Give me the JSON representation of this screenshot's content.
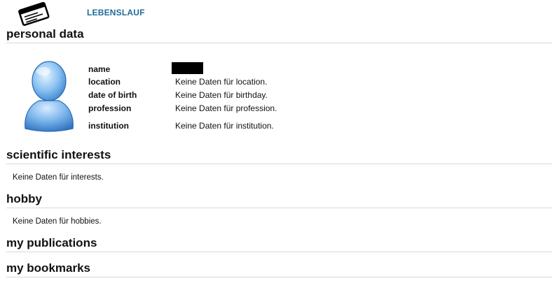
{
  "header": {
    "title": "LEBENSLAUF",
    "logo_icon": "id-card-icon"
  },
  "personal": {
    "heading": "personal data",
    "avatar_icon": "user-avatar-icon",
    "fields": [
      {
        "label": "name",
        "value": ""
      },
      {
        "label": "location",
        "value": "Keine Daten für location."
      },
      {
        "label": "date of birth",
        "value": "Keine Daten für birthday."
      },
      {
        "label": "profession",
        "value": "Keine Daten für profession."
      },
      {
        "label": "institution",
        "value": "Keine Daten für institution."
      }
    ]
  },
  "interests": {
    "heading": "scientific interests",
    "text": "Keine Daten für interests."
  },
  "hobby": {
    "heading": "hobby",
    "text": "Keine Daten für hobbies."
  },
  "publications": {
    "heading": "my publications"
  },
  "bookmarks": {
    "heading": "my bookmarks"
  },
  "colors": {
    "title": "#1f6a9a",
    "avatar": "#5aa6e8",
    "divider": "#d9d9d9"
  }
}
